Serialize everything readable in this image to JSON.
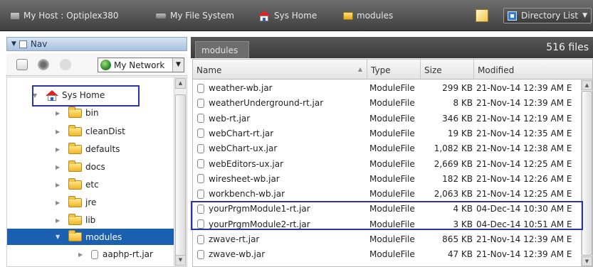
{
  "topbar": {
    "crumbs": [
      "My Host : Optiplex380",
      "My File System",
      "Sys Home",
      "modules"
    ],
    "view_select": "Directory List"
  },
  "nav": {
    "title": "Nav",
    "network_select": "My Network",
    "tree": {
      "root": "Sys Home",
      "folders": [
        "bin",
        "cleanDist",
        "defaults",
        "docs",
        "etc",
        "jre",
        "lib",
        "modules"
      ],
      "selected": "modules",
      "child_file": "aaphp-rt.jar"
    }
  },
  "filelist": {
    "tab": "modules",
    "count": "516 files",
    "columns": [
      "Name",
      "Type",
      "Size",
      "Modified"
    ],
    "rows": [
      {
        "name": "weather-wb.jar",
        "type": "ModuleFile",
        "size": "299 KB",
        "modified": "21-Nov-14 12:39 AM E"
      },
      {
        "name": "weatherUnderground-rt.jar",
        "type": "ModuleFile",
        "size": "8 KB",
        "modified": "21-Nov-14 12:39 AM E"
      },
      {
        "name": "web-rt.jar",
        "type": "ModuleFile",
        "size": "346 KB",
        "modified": "21-Nov-14 12:19 AM E"
      },
      {
        "name": "webChart-rt.jar",
        "type": "ModuleFile",
        "size": "19 KB",
        "modified": "21-Nov-14 12:35 AM E"
      },
      {
        "name": "webChart-ux.jar",
        "type": "ModuleFile",
        "size": "1,082 KB",
        "modified": "21-Nov-14 12:38 AM E"
      },
      {
        "name": "webEditors-ux.jar",
        "type": "ModuleFile",
        "size": "2,669 KB",
        "modified": "21-Nov-14 12:25 AM E"
      },
      {
        "name": "wiresheet-wb.jar",
        "type": "ModuleFile",
        "size": "182 KB",
        "modified": "21-Nov-14 12:26 AM E"
      },
      {
        "name": "workbench-wb.jar",
        "type": "ModuleFile",
        "size": "2,063 KB",
        "modified": "21-Nov-14 12:25 AM E"
      },
      {
        "name": "yourPrgmModule1-rt.jar",
        "type": "ModuleFile",
        "size": "4 KB",
        "modified": "04-Dec-14 10:30 AM E"
      },
      {
        "name": "yourPrgmModule2-rt.jar",
        "type": "ModuleFile",
        "size": "3 KB",
        "modified": "04-Dec-14 10:51 AM E"
      },
      {
        "name": "zwave-rt.jar",
        "type": "ModuleFile",
        "size": "865 KB",
        "modified": "21-Nov-14 12:39 AM E"
      },
      {
        "name": "zwave-wb.jar",
        "type": "ModuleFile",
        "size": "47 KB",
        "modified": "21-Nov-14 12:39 AM E"
      }
    ]
  }
}
